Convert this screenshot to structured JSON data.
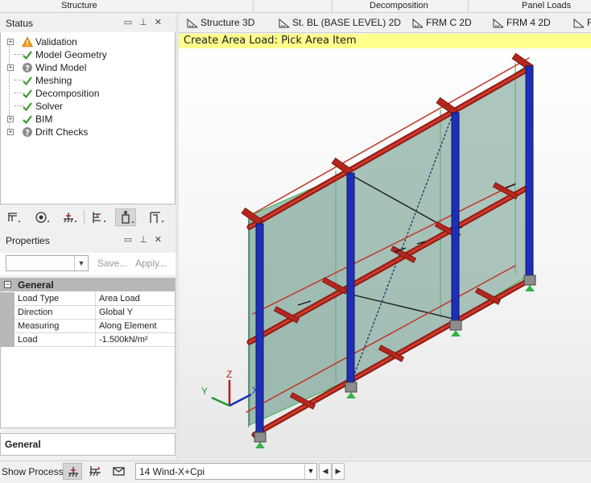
{
  "top_tabs": [
    "Structure",
    "Decomposition",
    "Panel Loads"
  ],
  "status_panel": {
    "title": "Status",
    "header_buttons": [
      "▭",
      "⊥",
      "✕"
    ],
    "items": [
      {
        "label": "Validation",
        "status": "warning-icon",
        "expandable": true
      },
      {
        "label": "Model Geometry",
        "status": "check-icon",
        "expandable": false
      },
      {
        "label": "Wind Model",
        "status": "question-icon",
        "expandable": true
      },
      {
        "label": "Meshing",
        "status": "check-icon",
        "expandable": false
      },
      {
        "label": "Decomposition",
        "status": "check-icon",
        "expandable": false
      },
      {
        "label": "Solver",
        "status": "check-icon",
        "expandable": false
      },
      {
        "label": "BIM",
        "status": "check-icon",
        "expandable": true
      },
      {
        "label": "Drift Checks",
        "status": "question-icon",
        "expandable": true
      }
    ]
  },
  "properties_panel": {
    "title": "Properties",
    "save_label": "Save...",
    "apply_label": "Apply...",
    "category": "General",
    "rows": [
      {
        "key": "Load Type",
        "value": "Area Load"
      },
      {
        "key": "Direction",
        "value": "Global Y"
      },
      {
        "key": "Measuring",
        "value": "Along Element"
      },
      {
        "key": "Load",
        "value": "-1.500kN/m²"
      }
    ],
    "description_title": "General"
  },
  "view_tabs": [
    "Structure 3D",
    "St. BL (BASE LEVEL) 2D",
    "FRM C 2D",
    "FRM 4 2D",
    "F"
  ],
  "banner": "Create Area Load: Pick Area Item",
  "axes": {
    "x": "X",
    "y": "Y",
    "z": "Z"
  },
  "bottom_bar": {
    "show_process_label": "Show Process",
    "load_case": "14 Wind-X+Cpi"
  },
  "colors": {
    "banner": "#ffff8c",
    "column": "#1d2fb5",
    "beam": "#b3261e",
    "panel": "#7ea69a"
  }
}
